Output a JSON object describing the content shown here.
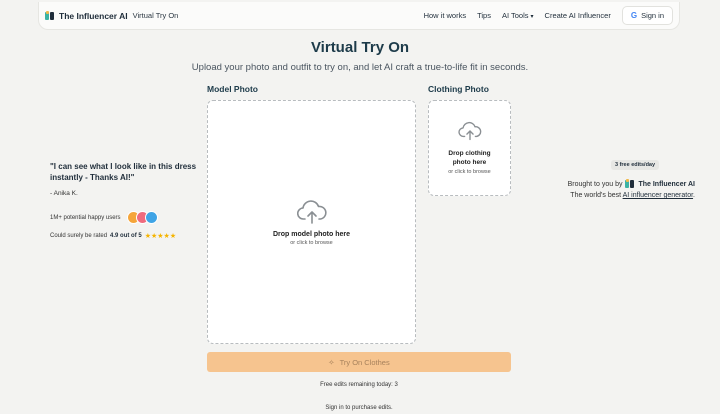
{
  "header": {
    "brand": "The Influencer AI",
    "subtitle": "Virtual Try On",
    "nav": [
      {
        "label": "How it works"
      },
      {
        "label": "Tips"
      },
      {
        "label": "AI Tools"
      },
      {
        "label": "Create AI Influencer"
      }
    ],
    "signin_label": "Sign in",
    "google_glyph": "G"
  },
  "page": {
    "title": "Virtual Try On",
    "lead": "Upload your photo and outfit to try on, and let AI craft a true-to-life fit in seconds."
  },
  "model": {
    "label": "Model Photo",
    "drop_title": "Drop model photo here",
    "drop_sub": "or click to browse"
  },
  "clothing": {
    "label": "Clothing Photo",
    "drop_title_line1": "Drop clothing",
    "drop_title_line2": "photo here",
    "drop_sub": "or click to browse"
  },
  "testimonial": {
    "quote": "\"I can see what I look like in this dress instantly - Thanks AI!\"",
    "author": "- Anika K.",
    "users_text": "1M+ potential happy users",
    "avatar_colors": [
      "#f5a53a",
      "#ef6b7e",
      "#3fa4e6"
    ],
    "rating_prefix": "Could surely be rated",
    "rating_value": "4.9 out of 5",
    "stars": "★★★★★"
  },
  "credit": {
    "badge": "3 free edits/day",
    "brought_prefix": "Brought to you by",
    "brand": "The Influencer AI",
    "worlds_prefix": "The world's best",
    "link": "AI influencer generator",
    "suffix": "."
  },
  "actions": {
    "try_label": "Try On Clothes",
    "remaining": "Free edits remaining today: 3",
    "purchase": "Sign in to purchase edits."
  },
  "colors": {
    "accent": "#f6c48f",
    "title": "#1d3b4a"
  }
}
